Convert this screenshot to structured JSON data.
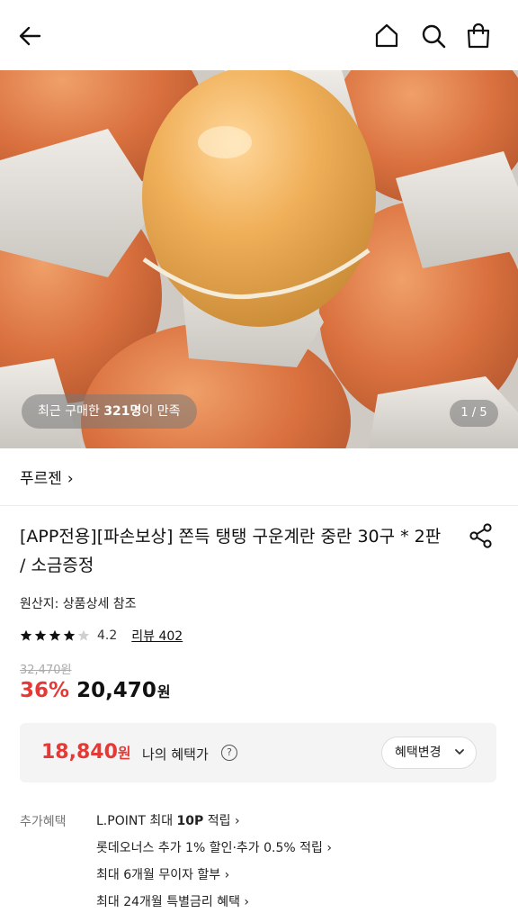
{
  "hero": {
    "buyers_prefix": "최근 구매한 ",
    "buyers_count": "321명",
    "buyers_suffix": "이 만족",
    "counter": "1 / 5"
  },
  "brand": {
    "name": "푸르젠",
    "chevron": "›"
  },
  "product": {
    "title": "[APP전용][파손보상] 쫀득 탱탱 구운계란 중란 30구 * 2판 / 소금증정",
    "origin": "원산지: 상품상세 참조",
    "rating": 4.2,
    "rating_text": "4.2",
    "review_link": "리뷰 402",
    "original_price": "32,470원",
    "discount": "36%",
    "price": "20,470",
    "currency": "원"
  },
  "benefit": {
    "price": "18,840",
    "currency": "원",
    "label": "나의 혜택가",
    "help": "?",
    "change_button": "혜택변경",
    "change_chevron": "⌄"
  },
  "extra": {
    "label": "추가혜택",
    "items": [
      {
        "pre": "L.POINT 최대 ",
        "bold": "10P",
        "post": " 적립 ›"
      },
      {
        "pre": "롯데오너스 추가 1% 할인·추가 0.5% 적립 ›",
        "bold": "",
        "post": ""
      },
      {
        "pre": "최대 6개월 무이자 할부 ›",
        "bold": "",
        "post": ""
      },
      {
        "pre": "최대 24개월 특별금리 혜택 ›",
        "bold": "",
        "post": ""
      }
    ]
  },
  "icons": {
    "back": "arrow-left-icon",
    "home": "home-icon",
    "search": "search-icon",
    "bag": "shopping-bag-icon",
    "share": "share-icon",
    "star": "star-icon"
  },
  "colors": {
    "accent_red": "#e53935",
    "text": "#111111",
    "muted": "#777777",
    "benefit_bg": "#f4f4f4"
  }
}
